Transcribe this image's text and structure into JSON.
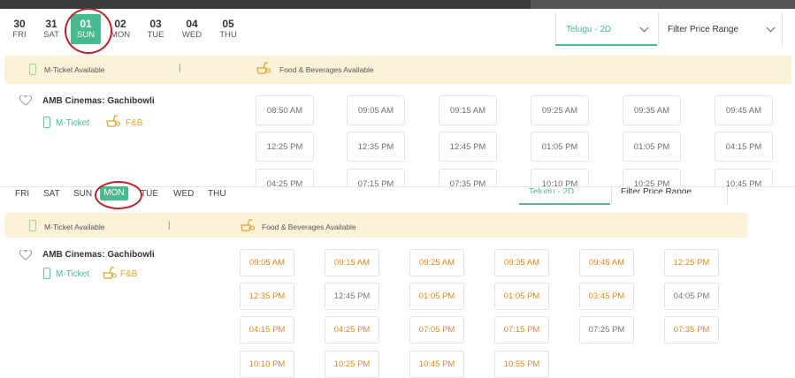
{
  "top": {
    "dates": [
      {
        "num": "30",
        "day": "FRI",
        "active": false
      },
      {
        "num": "31",
        "day": "SAT",
        "active": false
      },
      {
        "num": "01",
        "day": "SUN",
        "active": true
      },
      {
        "num": "02",
        "day": "MON",
        "active": false
      },
      {
        "num": "03",
        "day": "TUE",
        "active": false
      },
      {
        "num": "04",
        "day": "WED",
        "active": false
      },
      {
        "num": "05",
        "day": "THU",
        "active": false
      }
    ],
    "language": "Telugu - 2D",
    "price_filter": "Filter Price Range",
    "info": {
      "mticket": "M-Ticket Available",
      "food": "Food & Beverages Available",
      "pipe": "|"
    },
    "cinema": {
      "name": "AMB Cinemas: Gachibowli",
      "mticket": "M-Ticket",
      "fb": "F&B"
    },
    "showtimes": [
      "08:50 AM",
      "09:05 AM",
      "09:15 AM",
      "09:25 AM",
      "09:35 AM",
      "09:45 AM",
      "12:25 PM",
      "12:35 PM",
      "12:45 PM",
      "01:05 PM",
      "01:05 PM",
      "04:15 PM",
      "04:25 PM",
      "07:15 PM",
      "07:35 PM",
      "10:10 PM",
      "10:25 PM",
      "10:45 PM"
    ]
  },
  "bottom": {
    "days": [
      {
        "day": "FRI",
        "active": false
      },
      {
        "day": "SAT",
        "active": false
      },
      {
        "day": "SUN",
        "active": false
      },
      {
        "day": "MON",
        "active": true
      },
      {
        "day": "TUE",
        "active": false
      },
      {
        "day": "WED",
        "active": false
      },
      {
        "day": "THU",
        "active": false
      }
    ],
    "language": "Telugu - 2D",
    "price_filter": "Filter Price Range",
    "info": {
      "mticket": "M-Ticket Available",
      "food": "Food & Beverages Available",
      "pipe": "|"
    },
    "cinema": {
      "name": "AMB Cinemas: Gachibowli",
      "mticket": "M-Ticket",
      "fb": "F&B"
    },
    "showtimes": [
      {
        "t": "09:05 AM",
        "c": "o"
      },
      {
        "t": "09:15 AM",
        "c": "o"
      },
      {
        "t": "09:25 AM",
        "c": "o"
      },
      {
        "t": "09:35 AM",
        "c": "o"
      },
      {
        "t": "09:45 AM",
        "c": "o"
      },
      {
        "t": "12:25 PM",
        "c": "o"
      },
      {
        "t": "12:35 PM",
        "c": "o"
      },
      {
        "t": "12:45 PM",
        "c": "g"
      },
      {
        "t": "01:05 PM",
        "c": "o"
      },
      {
        "t": "01:05 PM",
        "c": "o"
      },
      {
        "t": "03:45 PM",
        "c": "o"
      },
      {
        "t": "04:05 PM",
        "c": "g"
      },
      {
        "t": "04:15 PM",
        "c": "o"
      },
      {
        "t": "04:25 PM",
        "c": "o"
      },
      {
        "t": "07:05 PM",
        "c": "o"
      },
      {
        "t": "07:15 PM",
        "c": "o"
      },
      {
        "t": "07:25 PM",
        "c": "g"
      },
      {
        "t": "07:35 PM",
        "c": "o"
      },
      {
        "t": "10:10 PM",
        "c": "o"
      },
      {
        "t": "10:25 PM",
        "c": "o"
      },
      {
        "t": "10:45 PM",
        "c": "o"
      },
      {
        "t": "10:55 PM",
        "c": "o"
      }
    ]
  }
}
